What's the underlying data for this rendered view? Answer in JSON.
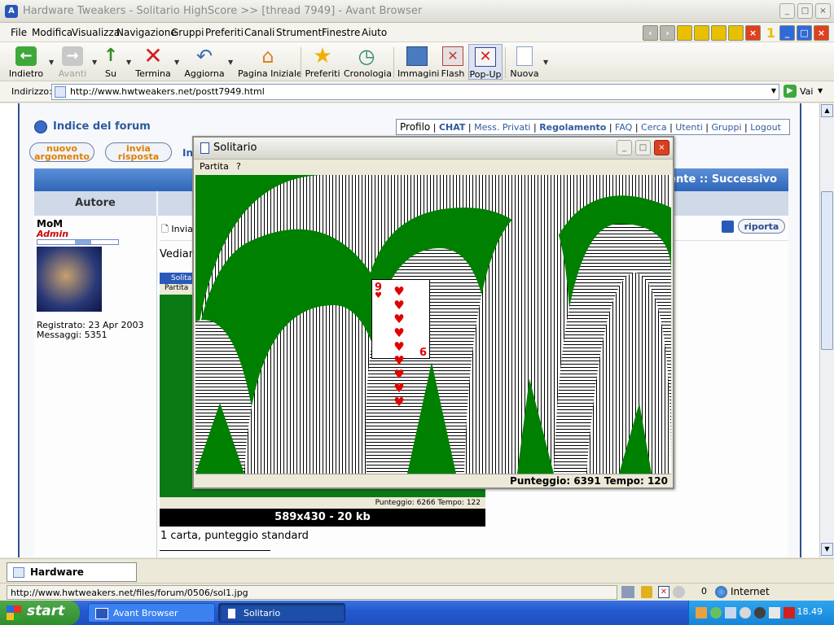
{
  "browser": {
    "title": "Hardware Tweakers - Solitario HighScore >> [thread 7949] - Avant Browser",
    "tab_counter": "1",
    "menu": [
      "File",
      "Modifica",
      "Visualizza",
      "Navigazione",
      "Gruppi",
      "Preferiti",
      "Canali",
      "Strumenti",
      "Finestre",
      "Aiuto"
    ],
    "toolbar": {
      "back": "Indietro",
      "forward": "Avanti",
      "up": "Su",
      "stop": "Termina",
      "refresh": "Aggiorna",
      "home": "Pagina Iniziale",
      "favorites": "Preferiti",
      "history": "Cronologia",
      "images": "Immagini",
      "flash": "Flash",
      "popup": "Pop-Up",
      "new": "Nuova"
    },
    "address": {
      "label": "Indirizzo:",
      "url": "http://www.hwtweakers.net/postt7949.html",
      "go": "Vai"
    },
    "tab": "Hardware Tweakers -...",
    "status_url": "http://www.hwtweakers.net/files/forum/0506/sol1.jpg",
    "status_count": "0",
    "zone": "Internet"
  },
  "forum": {
    "index_link": "Indice del forum",
    "nav": {
      "profilo": "Profilo",
      "chat": "CHAT",
      "messaggi": "Mess. Privati",
      "regolamento": "Regolamento",
      "faq": "FAQ",
      "cerca": "Cerca",
      "utenti": "Utenti",
      "gruppi": "Gruppi",
      "logout": "Logout"
    },
    "new_topic": {
      "l1": "nuovo",
      "l2": "argomento"
    },
    "reply": {
      "l1": "invia",
      "l2": "risposta"
    },
    "in_frag": "In",
    "prev_next": {
      "prev": "edente",
      "sep": "::",
      "next": "Successivo"
    },
    "author_header": "Autore",
    "author": {
      "name": "MoM",
      "role": "Admin",
      "registered": "Registrato: 23 Apr 2003",
      "posts": "Messaggi: 5351"
    },
    "post_header_frag": "Invia",
    "report": "riporta",
    "body_frag": "Vedian",
    "embedded": {
      "title_frag": "Solita",
      "menu": [
        "Partita",
        "?"
      ],
      "status": "Punteggio: 6266 Tempo: 122",
      "caption": "589x430 - 20 kb"
    },
    "post_text": "1 carta, punteggio standard"
  },
  "solitario": {
    "title": "Solitario",
    "menu": [
      "Partita",
      "?"
    ],
    "status": "Punteggio: 6391 Tempo: 120",
    "card": {
      "rank": "9",
      "suit": "♥",
      "color": "#e00000"
    }
  },
  "taskbar": {
    "start": "start",
    "tasks": [
      "Avant Browser",
      "Solitario"
    ],
    "clock": "18.49"
  }
}
